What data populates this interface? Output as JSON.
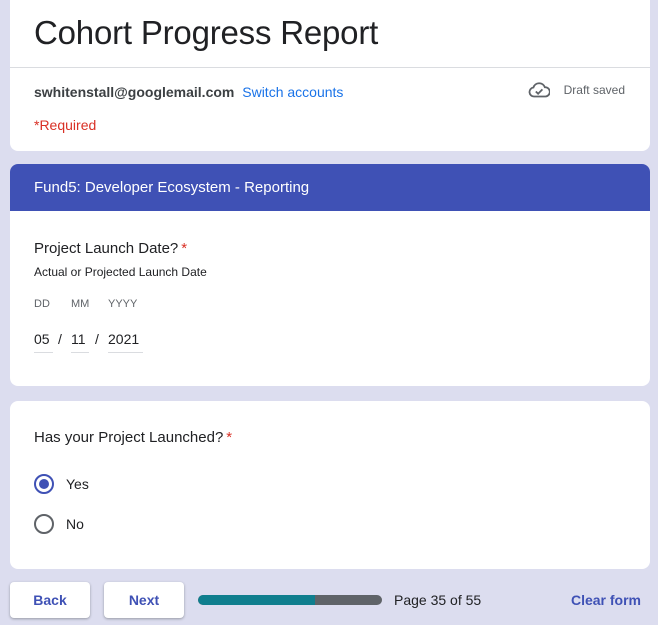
{
  "form": {
    "title": "Cohort Progress Report",
    "account_email": "swhitenstall@googlemail.com",
    "switch_accounts": "Switch accounts",
    "draft_status": "Draft saved",
    "required_note": "*Required"
  },
  "section": {
    "title": "Fund5: Developer Ecosystem - Reporting"
  },
  "launch_date_question": {
    "title": "Project Launch Date?",
    "required_mark": "*",
    "description": "Actual or Projected Launch Date",
    "labels": {
      "day": "DD",
      "month": "MM",
      "year": "YYYY"
    },
    "values": {
      "day": "05",
      "month": "11",
      "year": "2021"
    },
    "separator": "/"
  },
  "launched_question": {
    "title": "Has your Project Launched?",
    "required_mark": "*",
    "options": [
      {
        "label": "Yes",
        "selected": true
      },
      {
        "label": "No",
        "selected": false
      }
    ]
  },
  "footer": {
    "back_label": "Back",
    "next_label": "Next",
    "page_indicator": "Page 35 of 55",
    "progress_fraction": 0.636,
    "clear_label": "Clear form"
  },
  "colors": {
    "accent": "#3f51b5",
    "background": "#dcddef",
    "progress": "#0f7e8e",
    "required": "#d93025",
    "link": "#1a73e8"
  },
  "icons": {
    "draft": "cloud-check-icon"
  }
}
